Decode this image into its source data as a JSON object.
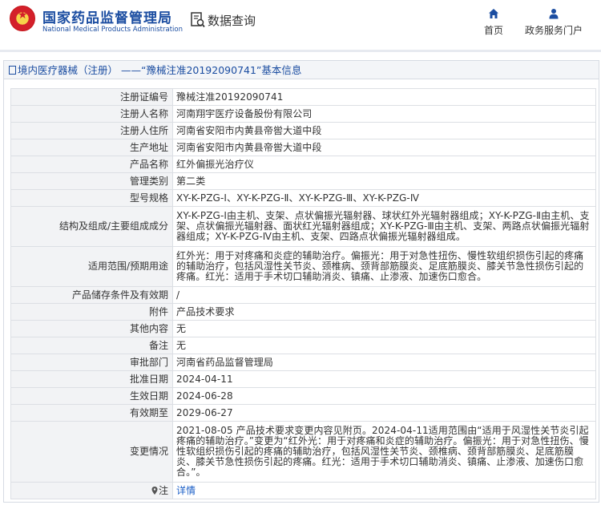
{
  "header": {
    "logo_cn": "国家药品监督管理局",
    "logo_en": "National Medical Products Administration",
    "query_title": "数据查询",
    "nav": [
      {
        "label": "首页",
        "icon": "home-icon"
      },
      {
        "label": "政务服务门户",
        "icon": "user-icon"
      }
    ]
  },
  "colors": {
    "brand_blue": "#1b4da1",
    "link_blue": "#1b5fc7",
    "label_bg": "#f2f3f5"
  },
  "panel": {
    "title": "境内医疗器械（注册） ——“豫械注准20192090741”基本信息"
  },
  "rows": [
    {
      "label": "注册证编号",
      "value": "豫械注准20192090741"
    },
    {
      "label": "注册人名称",
      "value": "河南翔宇医疗设备股份有限公司"
    },
    {
      "label": "注册人住所",
      "value": "河南省安阳市内黄县帝喾大道中段"
    },
    {
      "label": "生产地址",
      "value": "河南省安阳市内黄县帝喾大道中段"
    },
    {
      "label": "产品名称",
      "value": "红外偏振光治疗仪"
    },
    {
      "label": "管理类别",
      "value": "第二类"
    },
    {
      "label": "型号规格",
      "value": "XY-K-PZG-Ⅰ、XY-K-PZG-Ⅱ、XY-K-PZG-Ⅲ、XY-K-PZG-Ⅳ"
    },
    {
      "label": "结构及组成/主要组成成分",
      "value": "XY-K-PZG-Ⅰ由主机、支架、点状偏振光辐射器、球状红外光辐射器组成；XY-K-PZG-Ⅱ由主机、支架、点状偏振光辐射器、面状红光辐射器组成；XY-K-PZG-Ⅲ由主机、支架、两路点状偏振光辐射器组成；XY-K-PZG-Ⅳ由主机、支架、四路点状偏振光辐射器组成。"
    },
    {
      "label": "适用范围/预期用途",
      "value": "红外光：用于对疼痛和炎症的辅助治疗。偏振光：用于对急性扭伤、慢性软组织损伤引起的疼痛的辅助治疗，包括风湿性关节炎、颈椎病、颈背部筋膜炎、足底筋膜炎、膝关节急性损伤引起的疼痛。红光：适用于手术切口辅助消炎、镇痛、止渗液、加速伤口愈合。"
    },
    {
      "label": "产品储存条件及有效期",
      "value": "/"
    },
    {
      "label": "附件",
      "value": "产品技术要求"
    },
    {
      "label": "其他内容",
      "value": "无"
    },
    {
      "label": "备注",
      "value": "无"
    },
    {
      "label": "审批部门",
      "value": "河南省药品监督管理局"
    },
    {
      "label": "批准日期",
      "value": "2024-04-11"
    },
    {
      "label": "生效日期",
      "value": "2024-06-28"
    },
    {
      "label": "有效期至",
      "value": "2029-06-27"
    },
    {
      "label": "变更情况",
      "value": "2021-08-05 产品技术要求变更内容见附页。2024-04-11适用范围由“适用于风湿性关节炎引起疼痛的辅助治疗。”变更为“红外光：用于对疼痛和炎症的辅助治疗。偏振光：用于对急性扭伤、慢性软组织损伤引起的疼痛的辅助治疗，包括风湿性关节炎、颈椎病、颈背部筋膜炎、足底筋膜炎、膝关节急性损伤引起的疼痛。红光：适用于手术切口辅助消炎、镇痛、止渗液、加速伤口愈合。”。"
    },
    {
      "label": "注",
      "value": "详情"
    }
  ]
}
